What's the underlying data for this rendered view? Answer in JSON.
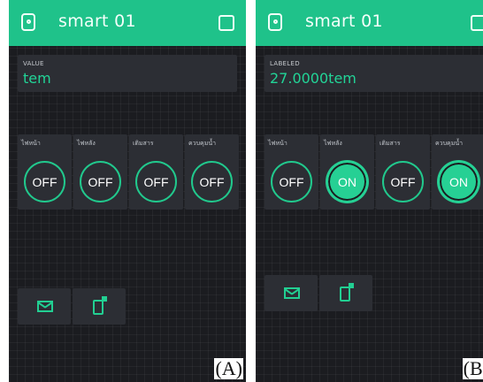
{
  "screens": [
    {
      "id": "a",
      "header": {
        "title": "smart 01",
        "device_icon": "device-icon",
        "menu_icon": "square-icon"
      },
      "display": {
        "label": "VALUE",
        "value": "tem"
      },
      "switches": [
        {
          "label": "ไฟหน้า",
          "state": "OFF"
        },
        {
          "label": "ไฟหลัง",
          "state": "OFF"
        },
        {
          "label": "เติมสาร",
          "state": "OFF"
        },
        {
          "label": "ควบคุมน้ำ",
          "state": "OFF"
        }
      ],
      "bottom_widgets": [
        {
          "icon": "mail-icon"
        },
        {
          "icon": "notification-icon"
        }
      ],
      "caption": "(A)"
    },
    {
      "id": "b",
      "header": {
        "title": "smart 01",
        "device_icon": "device-icon",
        "menu_icon": "square-icon"
      },
      "display": {
        "label": "LABELED",
        "value": "27.0000tem"
      },
      "switches": [
        {
          "label": "ไฟหน้า",
          "state": "OFF"
        },
        {
          "label": "ไฟหลัง",
          "state": "ON"
        },
        {
          "label": "เติมสาร",
          "state": "OFF"
        },
        {
          "label": "ควบคุมน้ำ",
          "state": "ON"
        }
      ],
      "bottom_widgets": [
        {
          "icon": "mail-icon"
        },
        {
          "icon": "notification-icon"
        }
      ],
      "caption": "(B)"
    }
  ],
  "colors": {
    "accent": "#1fc28a",
    "background": "#1b1c20",
    "widget": "#2c2e34",
    "value_text": "#22d497"
  }
}
